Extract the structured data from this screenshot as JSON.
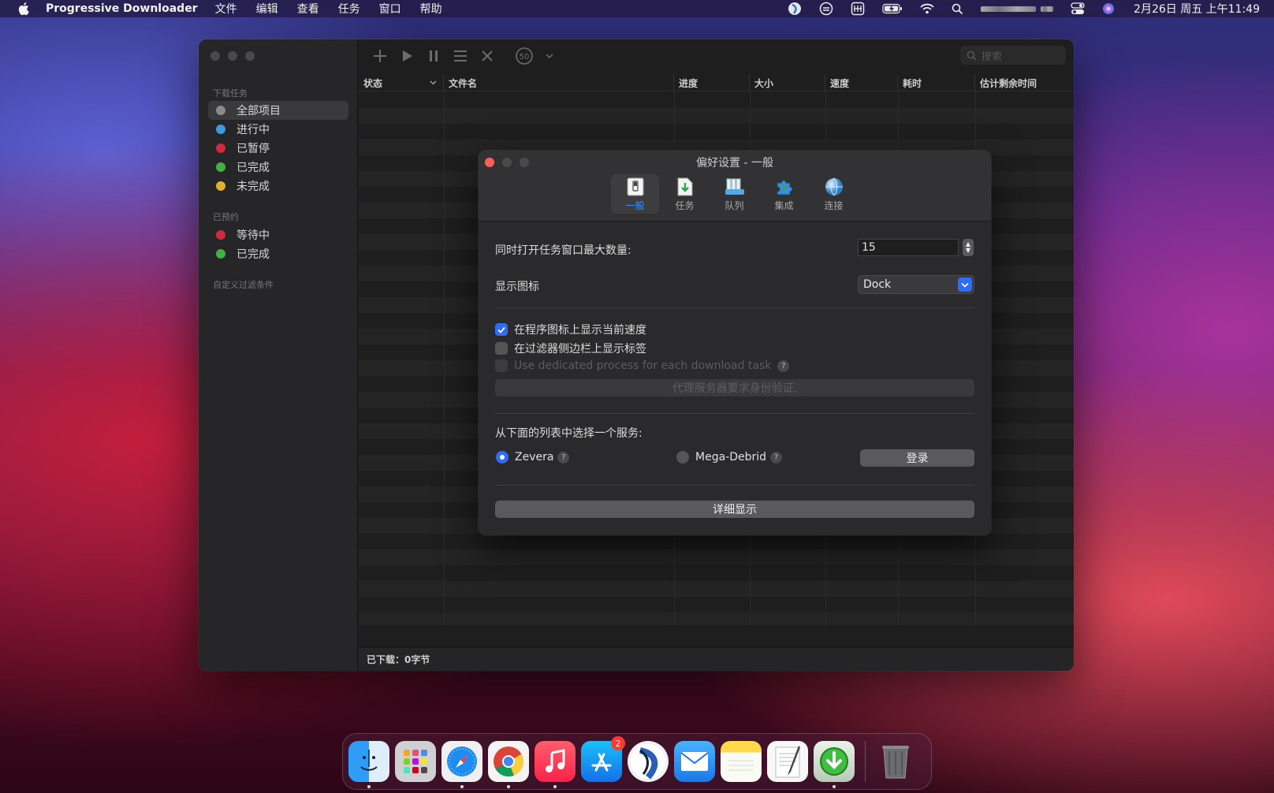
{
  "menubar": {
    "app_name": "Progressive Downloader",
    "menus": [
      "文件",
      "编辑",
      "查看",
      "任务",
      "窗口",
      "帮助"
    ],
    "clock": "2月26日 周五 上午11:49",
    "status_icons": [
      "app-status-icon",
      "sync-icon",
      "input-method-icon",
      "battery-icon",
      "wifi-icon",
      "spotlight-icon",
      "user-icon",
      "control-center-icon",
      "siri-icon"
    ]
  },
  "sidebar": {
    "section_downloads": "下载任务",
    "downloads": [
      {
        "label": "全部项目",
        "color": "#8a8a8a"
      },
      {
        "label": "进行中",
        "color": "#3b9be0"
      },
      {
        "label": "已暂停",
        "color": "#d4283f"
      },
      {
        "label": "已完成",
        "color": "#3fb23f"
      },
      {
        "label": "未完成",
        "color": "#e0b12b"
      }
    ],
    "section_scheduled": "已预约",
    "scheduled": [
      {
        "label": "等待中",
        "color": "#d4283f"
      },
      {
        "label": "已完成",
        "color": "#3fb23f"
      }
    ],
    "section_custom": "自定义过滤条件"
  },
  "toolbar": {
    "search_placeholder": "搜索",
    "speed_limit": "50"
  },
  "table": {
    "columns": [
      "状态",
      "文件名",
      "进度",
      "大小",
      "速度",
      "耗时",
      "估计剩余时间"
    ]
  },
  "footer": {
    "status": "已下载：0字节"
  },
  "prefs": {
    "title": "偏好设置 - 一般",
    "tabs": [
      "一般",
      "任务",
      "队列",
      "集成",
      "连接"
    ],
    "max_windows_label": "同时打开任务窗口最大数量:",
    "max_windows_value": "15",
    "show_icon_label": "显示图标",
    "show_icon_value": "Dock",
    "check_speed": "在程序图标上显示当前速度",
    "check_tags": "在过滤器侧边栏上显示标签",
    "check_dedicated": "Use dedicated process for each download task",
    "proxy_button": "代理服务器要求身份验证.",
    "service_label": "从下面的列表中选择一个服务:",
    "service_zevera": "Zevera",
    "service_megadebrid": "Mega-Debrid",
    "login_button": "登录",
    "details_button": "详细显示",
    "help_glyph": "?"
  },
  "dock": {
    "apps": [
      "finder-icon",
      "launchpad-icon",
      "safari-icon",
      "chrome-icon",
      "music-icon",
      "app-store-icon",
      "app-icon",
      "mail-icon",
      "notes-icon",
      "textedit-icon",
      "progressive-downloader-icon"
    ],
    "app_store_badge": "2",
    "trash": "trash-icon"
  }
}
